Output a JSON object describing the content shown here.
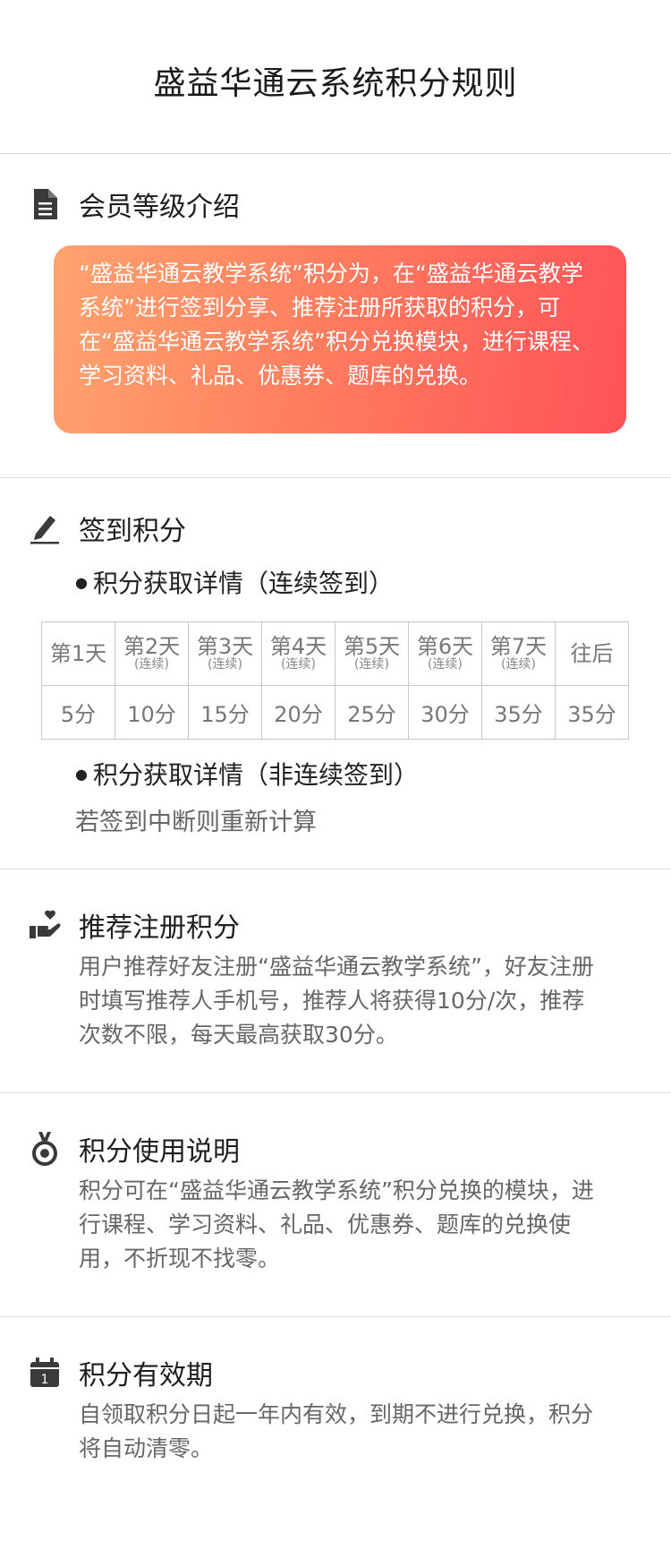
{
  "header": {
    "title": "盛益华通云系统积分规则"
  },
  "member": {
    "title": "会员等级介绍",
    "icon": "document-icon",
    "card_text": "“盛益华通云教学系统”积分为，在“盛益华通云教学系统”进行签到分享、推荐注册所获取的积分，可在“盛益华通云教学系统”积分兑换模块，进行课程、学习资料、礼品、优惠券、题库的兑换。",
    "card_gradient": [
      "#ffa46f",
      "#ff5258"
    ]
  },
  "sign": {
    "title": "签到积分",
    "icon": "pencil-icon",
    "consecutive_label": "积分获取详情（连续签到）",
    "days": [
      {
        "day": "第1天",
        "sub": ""
      },
      {
        "day": "第2天",
        "sub": "(连续)"
      },
      {
        "day": "第3天",
        "sub": "(连续)"
      },
      {
        "day": "第4天",
        "sub": "(连续)"
      },
      {
        "day": "第5天",
        "sub": "(连续)"
      },
      {
        "day": "第6天",
        "sub": "(连续)"
      },
      {
        "day": "第7天",
        "sub": "(连续)"
      },
      {
        "day": "往后",
        "sub": ""
      }
    ],
    "points": [
      "5分",
      "10分",
      "15分",
      "20分",
      "25分",
      "30分",
      "35分",
      "35分"
    ],
    "nonconsecutive_label": "积分获取详情（非连续签到）",
    "nonconsecutive_note": "若签到中断则重新计算"
  },
  "recommend": {
    "title": "推荐注册积分",
    "icon": "hand-heart-icon",
    "text": "用户推荐好友注册“盛益华通云教学系统”，好友注册时填写推荐人手机号，推荐人将获得10分/次，推荐次数不限，每天最高获取30分。"
  },
  "use": {
    "title": "积分使用说明",
    "icon": "medal-icon",
    "text": "积分可在“盛益华通云教学系统”积分兑换的模块，进行课程、学习资料、礼品、优惠券、题库的兑换使用，不折现不找零。"
  },
  "valid": {
    "title": "积分有效期",
    "icon": "calendar-icon",
    "calendar_day": "1",
    "text": "自领取积分日起一年内有效，到期不进行兑换，积分将自动清零。"
  }
}
